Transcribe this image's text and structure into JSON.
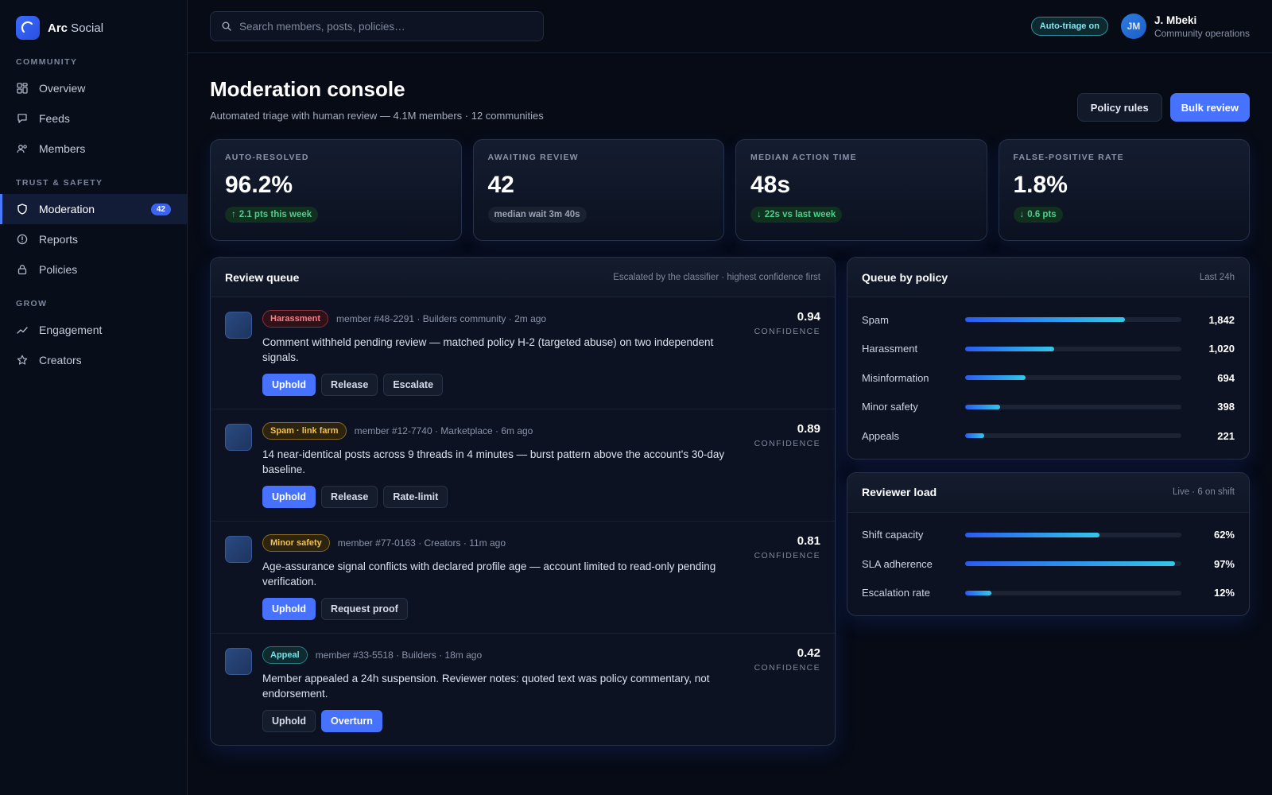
{
  "brand": {
    "bold": "Arc",
    "rest": " Social"
  },
  "nav": {
    "sections": [
      {
        "title": "COMMUNITY",
        "items": [
          {
            "label": "Overview",
            "icon": "grid-icon"
          },
          {
            "label": "Feeds",
            "icon": "chat-icon"
          },
          {
            "label": "Members",
            "icon": "users-icon"
          }
        ]
      },
      {
        "title": "TRUST & SAFETY",
        "items": [
          {
            "label": "Moderation",
            "icon": "shield-icon",
            "badge": "42",
            "active": true
          },
          {
            "label": "Reports",
            "icon": "alert-icon"
          },
          {
            "label": "Policies",
            "icon": "lock-icon"
          }
        ]
      },
      {
        "title": "GROW",
        "items": [
          {
            "label": "Engagement",
            "icon": "trend-icon"
          },
          {
            "label": "Creators",
            "icon": "star-icon"
          }
        ]
      }
    ]
  },
  "topbar": {
    "search_placeholder": "Search members, posts, policies…",
    "auto_triage": "Auto-triage on",
    "user": {
      "initials": "JM",
      "name": "J. Mbeki",
      "role": "Community operations"
    }
  },
  "page": {
    "title": "Moderation console",
    "subtitle": "Automated triage with human review — 4.1M members · 12 communities",
    "policy_rules": "Policy rules",
    "bulk_review": "Bulk review"
  },
  "stats": [
    {
      "label": "AUTO-RESOLVED",
      "value": "96.2%",
      "chip": "2.1 pts this week",
      "arrow": "↑",
      "style": "green"
    },
    {
      "label": "AWAITING REVIEW",
      "value": "42",
      "chip": "median wait 3m 40s",
      "arrow": "",
      "style": "gray"
    },
    {
      "label": "MEDIAN ACTION TIME",
      "value": "48s",
      "chip": "22s vs last week",
      "arrow": "↓",
      "style": "green"
    },
    {
      "label": "FALSE-POSITIVE RATE",
      "value": "1.8%",
      "chip": "0.6 pts",
      "arrow": "↓",
      "style": "green"
    }
  ],
  "queue": {
    "title": "Review queue",
    "note": "Escalated by the classifier · highest confidence first",
    "confidence_label": "CONFIDENCE",
    "items": [
      {
        "tag": "Harassment",
        "tag_style": "red",
        "meta": "member #48-2291 · Builders community · 2m ago",
        "text": "Comment withheld pending review — matched policy H-2 (targeted abuse) on two independent signals.",
        "score": "0.94",
        "actions": [
          {
            "label": "Uphold",
            "primary": true
          },
          {
            "label": "Release"
          },
          {
            "label": "Escalate"
          }
        ]
      },
      {
        "tag": "Spam · link farm",
        "tag_style": "amber",
        "meta": "member #12-7740 · Marketplace · 6m ago",
        "text": "14 near-identical posts across 9 threads in 4 minutes — burst pattern above the account's 30-day baseline.",
        "score": "0.89",
        "actions": [
          {
            "label": "Uphold",
            "primary": true
          },
          {
            "label": "Release"
          },
          {
            "label": "Rate-limit"
          }
        ]
      },
      {
        "tag": "Minor safety",
        "tag_style": "amber",
        "meta": "member #77-0163 · Creators · 11m ago",
        "text": "Age-assurance signal conflicts with declared profile age — account limited to read-only pending verification.",
        "score": "0.81",
        "actions": [
          {
            "label": "Uphold",
            "primary": true
          },
          {
            "label": "Request proof"
          }
        ]
      },
      {
        "tag": "Appeal",
        "tag_style": "teal",
        "meta": "member #33-5518 · Builders · 18m ago",
        "text": "Member appealed a 24h suspension. Reviewer notes: quoted text was policy commentary, not endorsement.",
        "score": "0.42",
        "actions": [
          {
            "label": "Uphold"
          },
          {
            "label": "Overturn",
            "primary": true
          }
        ]
      }
    ]
  },
  "policy_queue": {
    "title": "Queue by policy",
    "note": "Last 24h",
    "rows": [
      {
        "label": "Spam",
        "display": "1,842",
        "value": 1842,
        "fill": 0.74
      },
      {
        "label": "Harassment",
        "display": "1,020",
        "value": 1020,
        "fill": 0.41
      },
      {
        "label": "Misinformation",
        "display": "694",
        "value": 694,
        "fill": 0.28
      },
      {
        "label": "Minor safety",
        "display": "398",
        "value": 398,
        "fill": 0.16
      },
      {
        "label": "Appeals",
        "display": "221",
        "value": 221,
        "fill": 0.09
      }
    ]
  },
  "reviewer_load": {
    "title": "Reviewer load",
    "note": "Live · 6 on shift",
    "rows": [
      {
        "label": "Shift capacity",
        "display": "62%",
        "fill": 0.62
      },
      {
        "label": "SLA adherence",
        "display": "97%",
        "fill": 0.97
      },
      {
        "label": "Escalation rate",
        "display": "12%",
        "fill": 0.12
      }
    ]
  },
  "colors": {
    "accent": "#4672ff",
    "positive": "#49d18a",
    "teal": "#72e2e8"
  }
}
